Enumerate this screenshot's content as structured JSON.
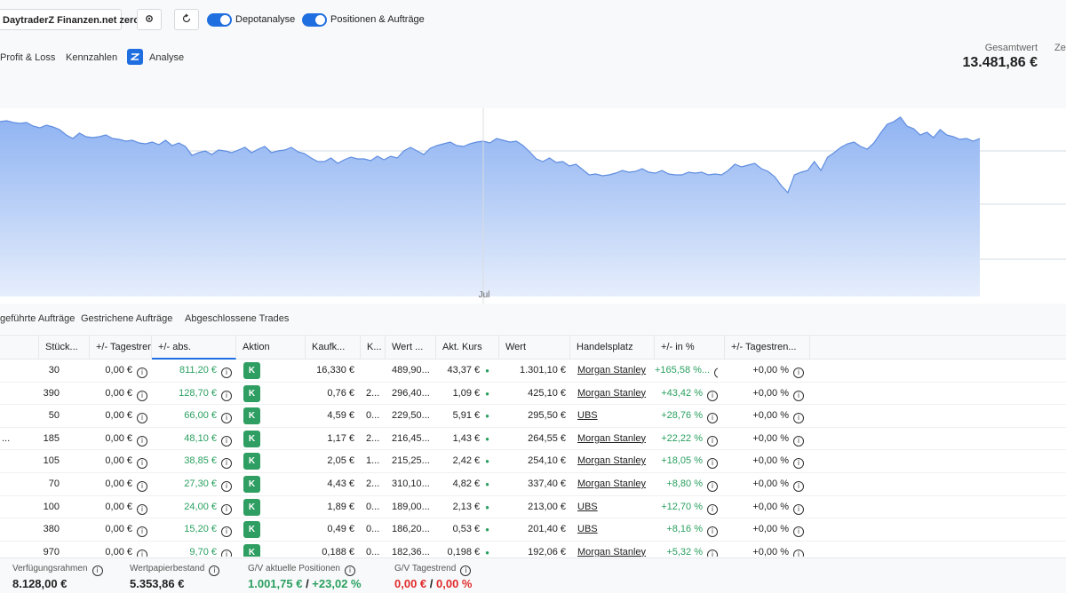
{
  "header": {
    "account": "DaytraderZ Finanzen.net zero",
    "toggles": [
      {
        "label": "Depotanalyse",
        "on": true
      },
      {
        "label": "Positionen & Aufträge",
        "on": true
      }
    ],
    "subnav": [
      "Profit & Loss",
      "Kennzahlen",
      "Analyse"
    ],
    "total_label": "Gesamtwert",
    "total_label2": "Ze",
    "total_value": "13.481,86 €"
  },
  "chart_data": {
    "type": "area",
    "xlabel": "",
    "ylabel": "",
    "x_tick_labels": [
      "Jul"
    ],
    "grid": true,
    "series": [
      {
        "values": [
          205,
          206,
          204,
          203,
          204,
          200,
          198,
          201,
          199,
          196,
          190,
          186,
          192,
          188,
          187,
          188,
          190,
          186,
          185,
          183,
          184,
          181,
          180,
          182,
          179,
          184,
          178,
          181,
          177,
          167,
          170,
          172,
          168,
          173,
          172,
          170,
          173,
          176,
          170,
          174,
          177,
          170,
          172,
          173,
          176,
          171,
          169,
          164,
          160,
          160,
          164,
          158,
          162,
          165,
          163,
          163,
          161,
          166,
          162,
          166,
          164,
          172,
          176,
          172,
          168,
          175,
          178,
          180,
          182,
          178,
          177,
          180,
          182,
          183,
          181,
          186,
          184,
          182,
          183,
          178,
          171,
          163,
          160,
          164,
          159,
          160,
          155,
          157,
          151,
          145,
          146,
          144,
          145,
          147,
          150,
          148,
          149,
          152,
          148,
          147,
          150,
          146,
          145,
          145,
          148,
          147,
          148,
          145,
          146,
          145,
          150,
          157,
          154,
          156,
          158,
          152,
          149,
          143,
          133,
          125,
          145,
          148,
          150,
          160,
          150,
          165,
          170,
          176,
          180,
          182,
          177,
          174,
          181,
          192,
          202,
          205,
          210,
          200,
          197,
          190,
          193,
          187,
          196,
          190,
          188,
          185,
          186,
          183,
          186
        ]
      }
    ],
    "fill_color": "#8fb3f2",
    "line_color": "#5f8de0"
  },
  "tabs": [
    "geführte Aufträge",
    "Gestrichene Aufträge",
    "Abgeschlossene Trades"
  ],
  "table": {
    "columns": [
      "Stück...",
      "+/- Tagestren...",
      "+/- abs.",
      "Aktion",
      "Kaufk...",
      "K...",
      "Wert ...",
      "Akt. Kurs",
      "Wert",
      "Handelsplatz",
      "+/- in %",
      "+/- Tagestren..."
    ],
    "rows": [
      {
        "name": "",
        "qty": "30",
        "day": "0,00 €",
        "abs": "811,20 €",
        "action": "K",
        "buy": "16,330 €",
        "k": "",
        "val1": "489,90...",
        "price": "43,37 €",
        "value": "1.301,10 €",
        "venue": "Morgan Stanley",
        "pct": "+165,58 %...",
        "daypct": "+0,00 %"
      },
      {
        "name": "",
        "qty": "390",
        "day": "0,00 €",
        "abs": "128,70 €",
        "action": "K",
        "buy": "0,76 €",
        "k": "2...",
        "val1": "296,40...",
        "price": "1,09 €",
        "value": "425,10 €",
        "venue": "Morgan Stanley",
        "pct": "+43,42 %",
        "daypct": "+0,00 %"
      },
      {
        "name": "",
        "qty": "50",
        "day": "0,00 €",
        "abs": "66,00 €",
        "action": "K",
        "buy": "4,59 €",
        "k": "0...",
        "val1": "229,50...",
        "price": "5,91 €",
        "value": "295,50 €",
        "venue": "UBS",
        "pct": "+28,76 %",
        "daypct": "+0,00 %"
      },
      {
        "name": "...",
        "qty": "185",
        "day": "0,00 €",
        "abs": "48,10 €",
        "action": "K",
        "buy": "1,17 €",
        "k": "2...",
        "val1": "216,45...",
        "price": "1,43 €",
        "value": "264,55 €",
        "venue": "Morgan Stanley",
        "pct": "+22,22 %",
        "daypct": "+0,00 %"
      },
      {
        "name": "",
        "qty": "105",
        "day": "0,00 €",
        "abs": "38,85 €",
        "action": "K",
        "buy": "2,05 €",
        "k": "1...",
        "val1": "215,25...",
        "price": "2,42 €",
        "value": "254,10 €",
        "venue": "Morgan Stanley",
        "pct": "+18,05 %",
        "daypct": "+0,00 %"
      },
      {
        "name": "",
        "qty": "70",
        "day": "0,00 €",
        "abs": "27,30 €",
        "action": "K",
        "buy": "4,43 €",
        "k": "2...",
        "val1": "310,10...",
        "price": "4,82 €",
        "value": "337,40 €",
        "venue": "Morgan Stanley",
        "pct": "+8,80 %",
        "daypct": "+0,00 %"
      },
      {
        "name": "",
        "qty": "100",
        "day": "0,00 €",
        "abs": "24,00 €",
        "action": "K",
        "buy": "1,89 €",
        "k": "0...",
        "val1": "189,00...",
        "price": "2,13 €",
        "value": "213,00 €",
        "venue": "UBS",
        "pct": "+12,70 %",
        "daypct": "+0,00 %"
      },
      {
        "name": "",
        "qty": "380",
        "day": "0,00 €",
        "abs": "15,20 €",
        "action": "K",
        "buy": "0,49 €",
        "k": "0...",
        "val1": "186,20...",
        "price": "0,53 €",
        "value": "201,40 €",
        "venue": "UBS",
        "pct": "+8,16 %",
        "daypct": "+0,00 %"
      },
      {
        "name": "",
        "qty": "970",
        "day": "0,00 €",
        "abs": "9,70 €",
        "action": "K",
        "buy": "0,188 €",
        "k": "0...",
        "val1": "182,36...",
        "price": "0,198 €",
        "value": "192,06 €",
        "venue": "Morgan Stanley",
        "pct": "+5,32 %",
        "daypct": "+0,00 %"
      }
    ]
  },
  "footer": {
    "credit_label": "Verfügungsrahmen",
    "credit_value": "8.128,00 €",
    "holdings_label": "Wertpapierbestand",
    "holdings_value": "5.353,86 €",
    "pnl_label": "G/V aktuelle Positionen",
    "pnl_abs": "1.001,75 €",
    "pnl_sep": " / ",
    "pnl_pct": "+23,02 %",
    "trend_label": "G/V Tagestrend",
    "trend_abs": "0,00 €",
    "trend_sep": " / ",
    "trend_pct": "0,00 %"
  },
  "colors": {
    "accent": "#1f6fe0",
    "positive": "#2aa060",
    "negative": "#e02b2b",
    "badge": "#2e9e62"
  }
}
